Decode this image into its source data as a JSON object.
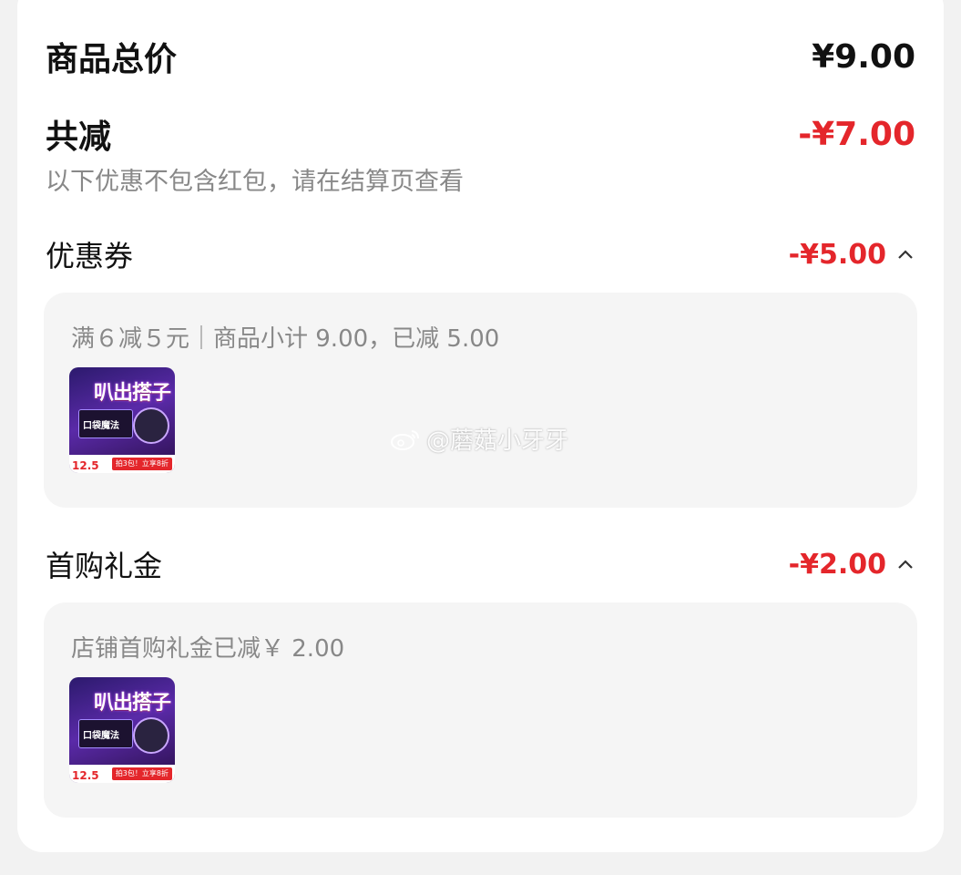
{
  "summary": {
    "total_label": "商品总价",
    "total_value": "¥9.00",
    "discount_label": "共减",
    "discount_value": "-¥7.00",
    "note": "以下优惠不包含红包，请在结算页查看"
  },
  "sections": [
    {
      "label": "优惠券",
      "value": "-¥5.00",
      "detail": "满６减５元｜商品小计 9.00，已减 5.00",
      "product": {
        "title": "叭出搭子",
        "pack_text": "口袋魔法",
        "price": "12.5",
        "tag": "拍3包！立享8折"
      }
    },
    {
      "label": "首购礼金",
      "value": "-¥2.00",
      "detail": "店铺首购礼金已减￥ 2.00",
      "product": {
        "title": "叭出搭子",
        "pack_text": "口袋魔法",
        "price": "12.5",
        "tag": "拍3包！立享8折"
      }
    }
  ],
  "watermark": "@蘑菇小牙牙",
  "colors": {
    "accent_red": "#e4262b",
    "panel_bg": "#f5f5f5"
  },
  "icons": {
    "expand": "chevron-up-icon",
    "watermark": "weibo-icon"
  }
}
